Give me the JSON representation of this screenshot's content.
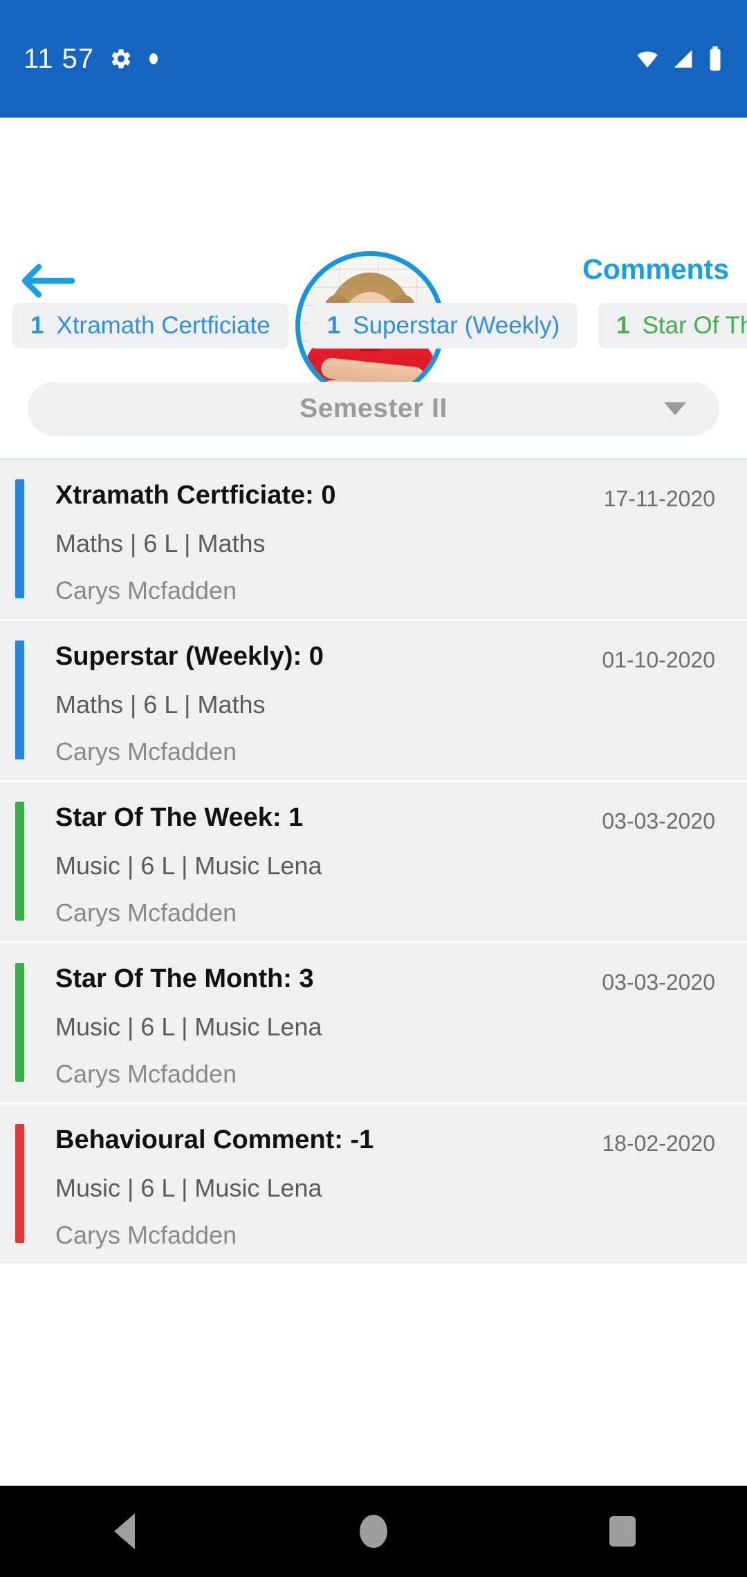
{
  "status_bar": {
    "time": "11 57",
    "left_icons": [
      "gear-icon",
      "dot-icon"
    ],
    "right_icons": [
      "wifi-icon",
      "cellular-signal-icon",
      "battery-icon"
    ],
    "background_color": "#1565C0"
  },
  "header": {
    "back_icon": "arrow-left-icon",
    "comments_label": "Comments",
    "comments_color": "#16A0E6",
    "avatar_alt": "student-photo",
    "avatar_ring_color": "#1497E0"
  },
  "chips": [
    {
      "count": "1",
      "label": "Xtramath Certficiate",
      "color": "#2F8FE8"
    },
    {
      "count": "1",
      "label": "Superstar (Weekly)",
      "color": "#2F8FE8"
    },
    {
      "count": "1",
      "label": "Star Of The",
      "color": "#41AF4B"
    }
  ],
  "semester_selector": {
    "value": "Semester II",
    "caret_icon": "chevron-down-icon"
  },
  "awards": [
    {
      "title": "Xtramath Certficiate: 0",
      "date": "17-11-2020",
      "meta": "Maths | 6 L | Maths",
      "person": "Carys Mcfadden",
      "accent_color": "#2684E0"
    },
    {
      "title": "Superstar (Weekly): 0",
      "date": "01-10-2020",
      "meta": "Maths | 6 L | Maths",
      "person": "Carys Mcfadden",
      "accent_color": "#2684E0"
    },
    {
      "title": "Star Of The Week: 1",
      "date": "03-03-2020",
      "meta": "Music | 6 L | Music Lena",
      "person": "Carys Mcfadden",
      "accent_color": "#3CAE4A"
    },
    {
      "title": "Star Of The Month: 3",
      "date": "03-03-2020",
      "meta": "Music | 6 L | Music Lena",
      "person": "Carys Mcfadden",
      "accent_color": "#3CAE4A"
    },
    {
      "title": "Behavioural Comment: -1",
      "date": "18-02-2020",
      "meta": "Music | 6 L | Music Lena",
      "person": "Carys Mcfadden",
      "accent_color": "#E03A34"
    }
  ],
  "nav_bar": {
    "back_icon": "triangle-back-icon",
    "home_icon": "circle-home-icon",
    "recents_icon": "square-recents-icon"
  }
}
